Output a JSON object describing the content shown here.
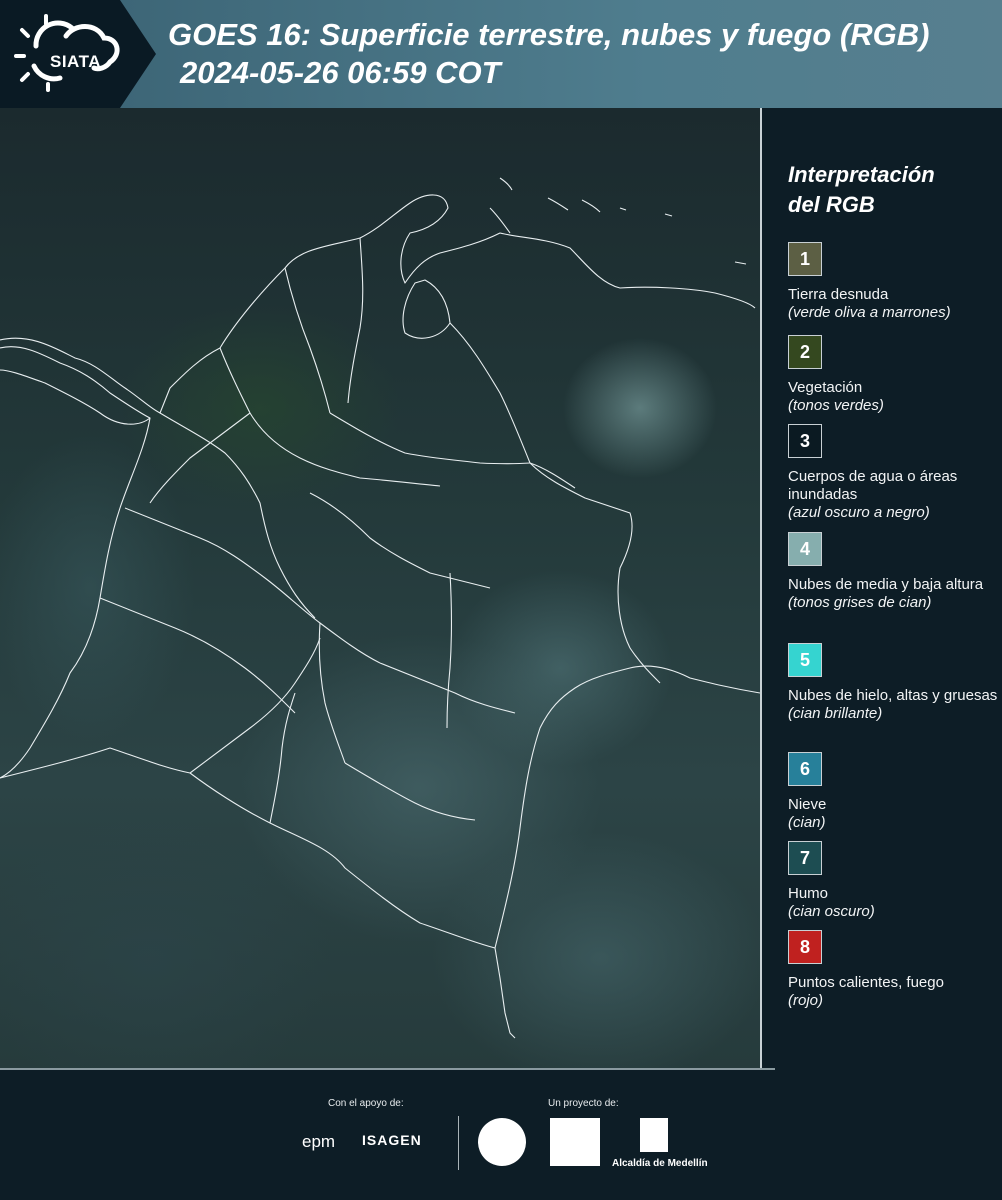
{
  "header": {
    "logo_text": "SIATA",
    "title": "GOES 16: Superficie terrestre, nubes y fuego (RGB)",
    "subtitle": "2024-05-26 06:59 COT"
  },
  "legend": {
    "title_line1": "Interpretación",
    "title_line2": "del RGB",
    "items": [
      {
        "num": "1",
        "color": "#5c5f44",
        "label": "Tierra desnuda",
        "note": "(verde oliva a marrones)"
      },
      {
        "num": "2",
        "color": "#34481f",
        "label": "Vegetación",
        "note": "(tonos verdes)"
      },
      {
        "num": "3",
        "color": "#0b1a22",
        "label": "Cuerpos de agua o áreas inundadas",
        "note": "(azul oscuro a negro)"
      },
      {
        "num": "4",
        "color": "#86aeae",
        "label": "Nubes de media y baja altura",
        "note": "(tonos grises de cian)"
      },
      {
        "num": "5",
        "color": "#35d4d0",
        "label": "Nubes de hielo, altas y gruesas",
        "note": "(cian brillante)"
      },
      {
        "num": "6",
        "color": "#27809a",
        "label": "Nieve",
        "note": "(cian)"
      },
      {
        "num": "7",
        "color": "#1d4d52",
        "label": "Humo",
        "note": "(cian oscuro)"
      },
      {
        "num": "8",
        "color": "#c0211f",
        "label": "Puntos calientes, fuego",
        "note": "(rojo)"
      }
    ]
  },
  "footer": {
    "support_label": "Con el apoyo de:",
    "project_label": "Un proyecto de:",
    "sponsor_epm": "epm",
    "sponsor_isagen": "ISAGEN",
    "alcaldia": "Alcaldía de Medellín"
  }
}
